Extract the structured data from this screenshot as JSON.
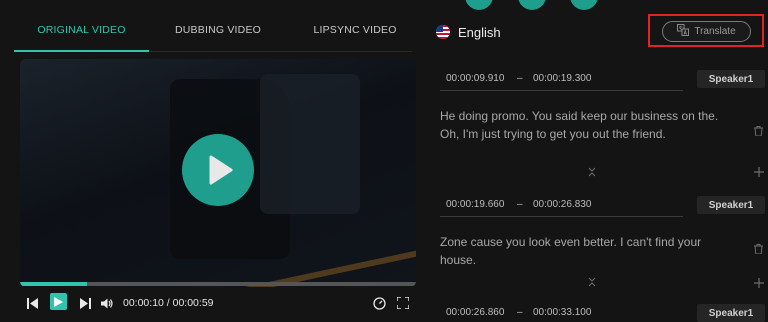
{
  "tabs": [
    {
      "label": "ORIGINAL VIDEO",
      "active": true
    },
    {
      "label": "DUBBING VIDEO",
      "active": false
    },
    {
      "label": "LIPSYNC VIDEO",
      "active": false
    }
  ],
  "language": {
    "label": "English",
    "icon": "us-flag-icon"
  },
  "translate": {
    "label": "Translate",
    "icon": "translate-icon"
  },
  "player": {
    "current_time": "00:00:10",
    "duration": "00:00:59",
    "time_display": "00:00:10 / 00:00:59",
    "progress": 0.17
  },
  "segments": [
    {
      "start": "00:00:09.910",
      "separator": "–",
      "end": "00:00:19.300",
      "speaker": "Speaker1",
      "text": "He doing promo. You said keep our business on the. Oh, I'm just trying to get you out the friend."
    },
    {
      "start": "00:00:19.660",
      "separator": "–",
      "end": "00:00:26.830",
      "speaker": "Speaker1",
      "text": "Zone cause you look even better. I can't find your house."
    },
    {
      "start": "00:00:26.860",
      "separator": "–",
      "end": "00:00:33.100",
      "speaker": "Speaker1",
      "text": ""
    }
  ],
  "colors": {
    "accent": "#31c3ad",
    "highlight": "#e02424",
    "background": "#141414"
  }
}
